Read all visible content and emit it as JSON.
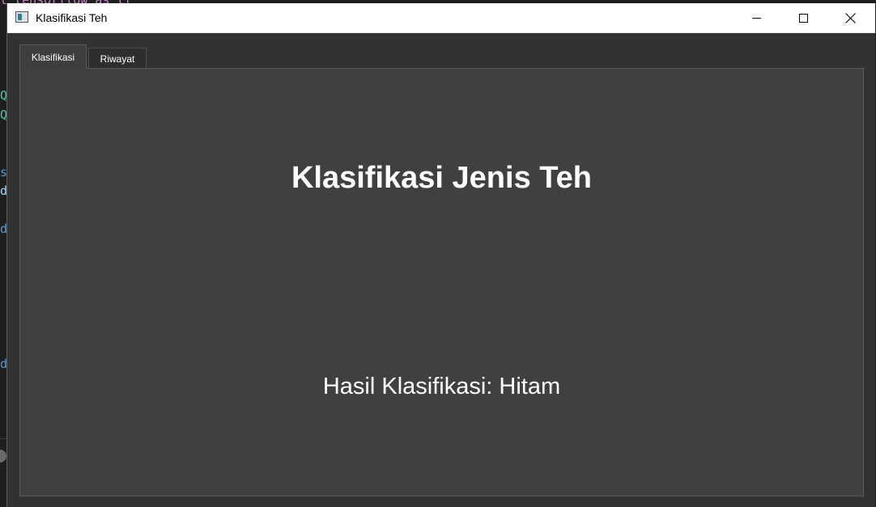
{
  "window": {
    "title": "Klasifikasi Teh",
    "icon": "app-window-icon"
  },
  "tabs": [
    {
      "label": "Klasifikasi",
      "active": true
    },
    {
      "label": "Riwayat",
      "active": false
    }
  ],
  "main": {
    "heading": "Klasifikasi Jenis Teh",
    "result_text": "Hasil Klasifikasi: Hitam"
  },
  "background_editor": {
    "top_fragment": "t tensorflow as tf",
    "glyphs": [
      {
        "text": "Q",
        "color": "#4ec9b0"
      },
      {
        "text": "Q",
        "color": "#4ec9b0"
      },
      {
        "text": "s",
        "color": "#569cd6"
      },
      {
        "text": "d",
        "color": "#9cdcfe"
      },
      {
        "text": "d",
        "color": "#569cd6"
      },
      {
        "text": "d",
        "color": "#569cd6"
      }
    ]
  },
  "colors": {
    "window_bg": "#323232",
    "panel_bg": "#404040",
    "titlebar_bg": "#ffffff",
    "text": "#ffffff"
  }
}
